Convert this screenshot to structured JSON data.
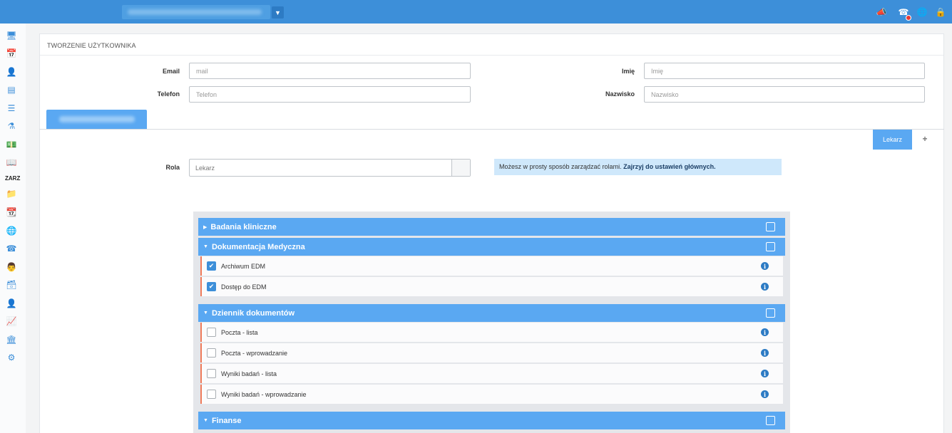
{
  "page_title": "TWORZENIE UŻYTKOWNIKA",
  "sidebar": {
    "section_label": "ZARZ"
  },
  "form": {
    "email": {
      "label": "Email",
      "placeholder": "mail"
    },
    "phone": {
      "label": "Telefon",
      "placeholder": "Telefon"
    },
    "first_name": {
      "label": "Imię",
      "placeholder": "Imię"
    },
    "last_name": {
      "label": "Nazwisko",
      "placeholder": "Nazwisko"
    }
  },
  "role_chip": "Lekarz",
  "role": {
    "label": "Rola",
    "value": "Lekarz"
  },
  "info": {
    "text": "Możesz w prosty sposób zarządzać rolami.",
    "link": "Zajrzyj do ustawień głównych."
  },
  "permissions": {
    "groups": [
      {
        "name": "Badania kliniczne",
        "expanded": false,
        "items": []
      },
      {
        "name": "Dokumentacja Medyczna",
        "expanded": true,
        "items": [
          {
            "label": "Archiwum EDM",
            "checked": true
          },
          {
            "label": "Dostęp do EDM",
            "checked": true
          }
        ]
      },
      {
        "name": "Dziennik dokumentów",
        "expanded": true,
        "items": [
          {
            "label": "Poczta - lista",
            "checked": false
          },
          {
            "label": "Poczta - wprowadzanie",
            "checked": false
          },
          {
            "label": "Wyniki badań - lista",
            "checked": false
          },
          {
            "label": "Wyniki badań - wprowadzanie",
            "checked": false
          }
        ]
      },
      {
        "name": "Finanse",
        "expanded": true,
        "items": []
      }
    ]
  },
  "colors": {
    "accent": "#3d8fd9",
    "group_bg": "#5aa8f2",
    "row_marker": "#ef7a5a",
    "info_bg": "#cfe8fb"
  }
}
